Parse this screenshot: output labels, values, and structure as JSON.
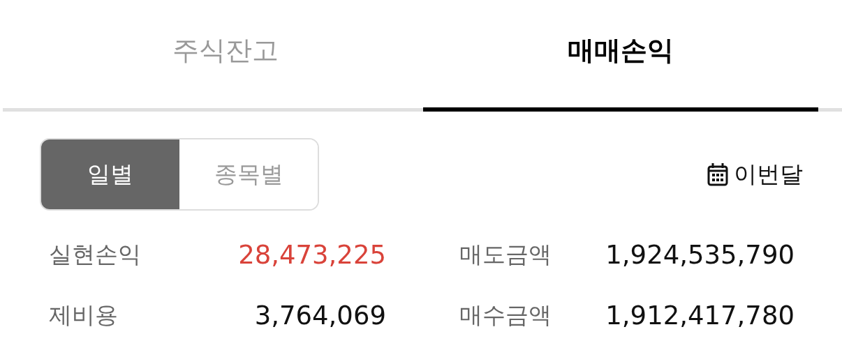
{
  "tabs": [
    {
      "label": "주식잔고",
      "selected": false
    },
    {
      "label": "매매손익",
      "selected": true
    }
  ],
  "view_toggle": [
    {
      "label": "일별",
      "selected": true
    },
    {
      "label": "종목별",
      "selected": false
    }
  ],
  "period": {
    "label": "이번달"
  },
  "summary": [
    {
      "label": "실현손익",
      "value": "28,473,225",
      "color": "#d9433a"
    },
    {
      "label": "매도금액",
      "value": "1,924,535,790",
      "color": "#111111"
    },
    {
      "label": "제비용",
      "value": "3,764,069",
      "color": "#111111"
    },
    {
      "label": "매수금액",
      "value": "1,912,417,780",
      "color": "#111111"
    }
  ]
}
